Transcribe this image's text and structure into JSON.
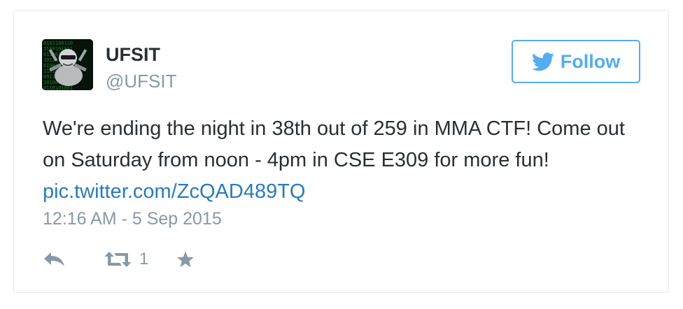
{
  "user": {
    "name": "UFSIT",
    "handle": "@UFSIT"
  },
  "follow": {
    "label": "Follow",
    "icon": "twitter-bird-icon"
  },
  "tweet": {
    "text": "We're ending the night in 38th out of 259 in MMA CTF! Come out on Saturday from noon - 4pm in CSE E309 for more fun! ",
    "link": "pic.twitter.com/ZcQAD489TQ",
    "timestamp": "12:16 AM - 5 Sep 2015"
  },
  "actions": {
    "reply_icon": "reply-icon",
    "retweet_icon": "retweet-icon",
    "retweet_count": "1",
    "favorite_icon": "star-icon"
  },
  "colors": {
    "accent": "#55acee",
    "link": "#2b7bb9",
    "text": "#292f33",
    "muted": "#8899a6",
    "border": "#e1e8ed"
  }
}
